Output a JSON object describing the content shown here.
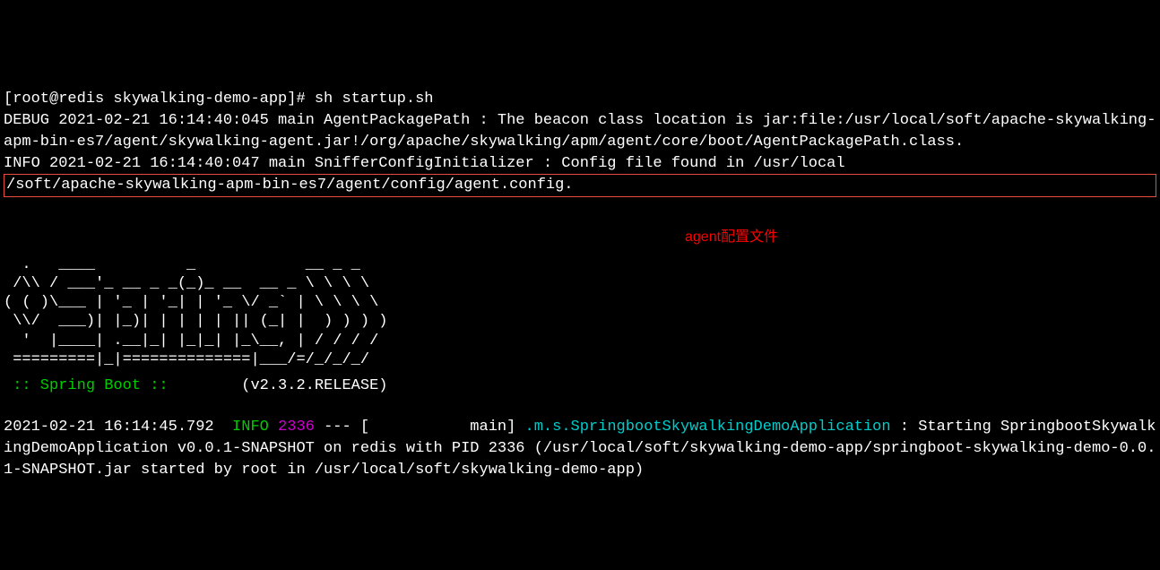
{
  "cmd_line": "[root@redis skywalking-demo-app]# sh startup.sh",
  "debug_line": "DEBUG 2021-02-21 16:14:40:045 main AgentPackagePath : The beacon class location is jar:file:/usr/local/soft/apache-skywalking-apm-bin-es7/agent/skywalking-agent.jar!/org/apache/skywalking/apm/agent/core/boot/AgentPackagePath.class.",
  "info_pre_box": "INFO 2021-02-21 16:14:40:047 main SnifferConfigInitializer : Config file found in /usr/local",
  "info_in_box": "/soft/apache-skywalking-apm-bin-es7/agent/config/agent.config.",
  "annotation_text": "agent配置文件",
  "ascii_art": "  .   ____          _            __ _ _\n /\\\\ / ___'_ __ _ _(_)_ __  __ _ \\ \\ \\ \\\n( ( )\\___ | '_ | '_| | '_ \\/ _` | \\ \\ \\ \\\n \\\\/  ___)| |_)| | | | | || (_| |  ) ) ) )\n  '  |____| .__|_| |_|_| |_\\__, | / / / /\n =========|_|==============|___/=/_/_/_/",
  "spring_banner_left": " :: Spring Boot :: ",
  "spring_banner_right": "       (v2.3.2.RELEASE)",
  "log_ts": "2021-02-21 16:14:45.792  ",
  "log_level": "INFO",
  "log_pid": " 2336",
  "log_thread": " --- [           main] ",
  "log_class": ".m.s.SpringbootSkywalkingDemoApplication",
  "log_msg": " : Starting SpringbootSkywalkingDemoApplication v0.0.1-SNAPSHOT on redis with PID 2336 (/usr/local/soft/skywalking-demo-app/springboot-skywalking-demo-0.0.1-SNAPSHOT.jar started by root in /usr/local/soft/skywalking-demo-app)"
}
